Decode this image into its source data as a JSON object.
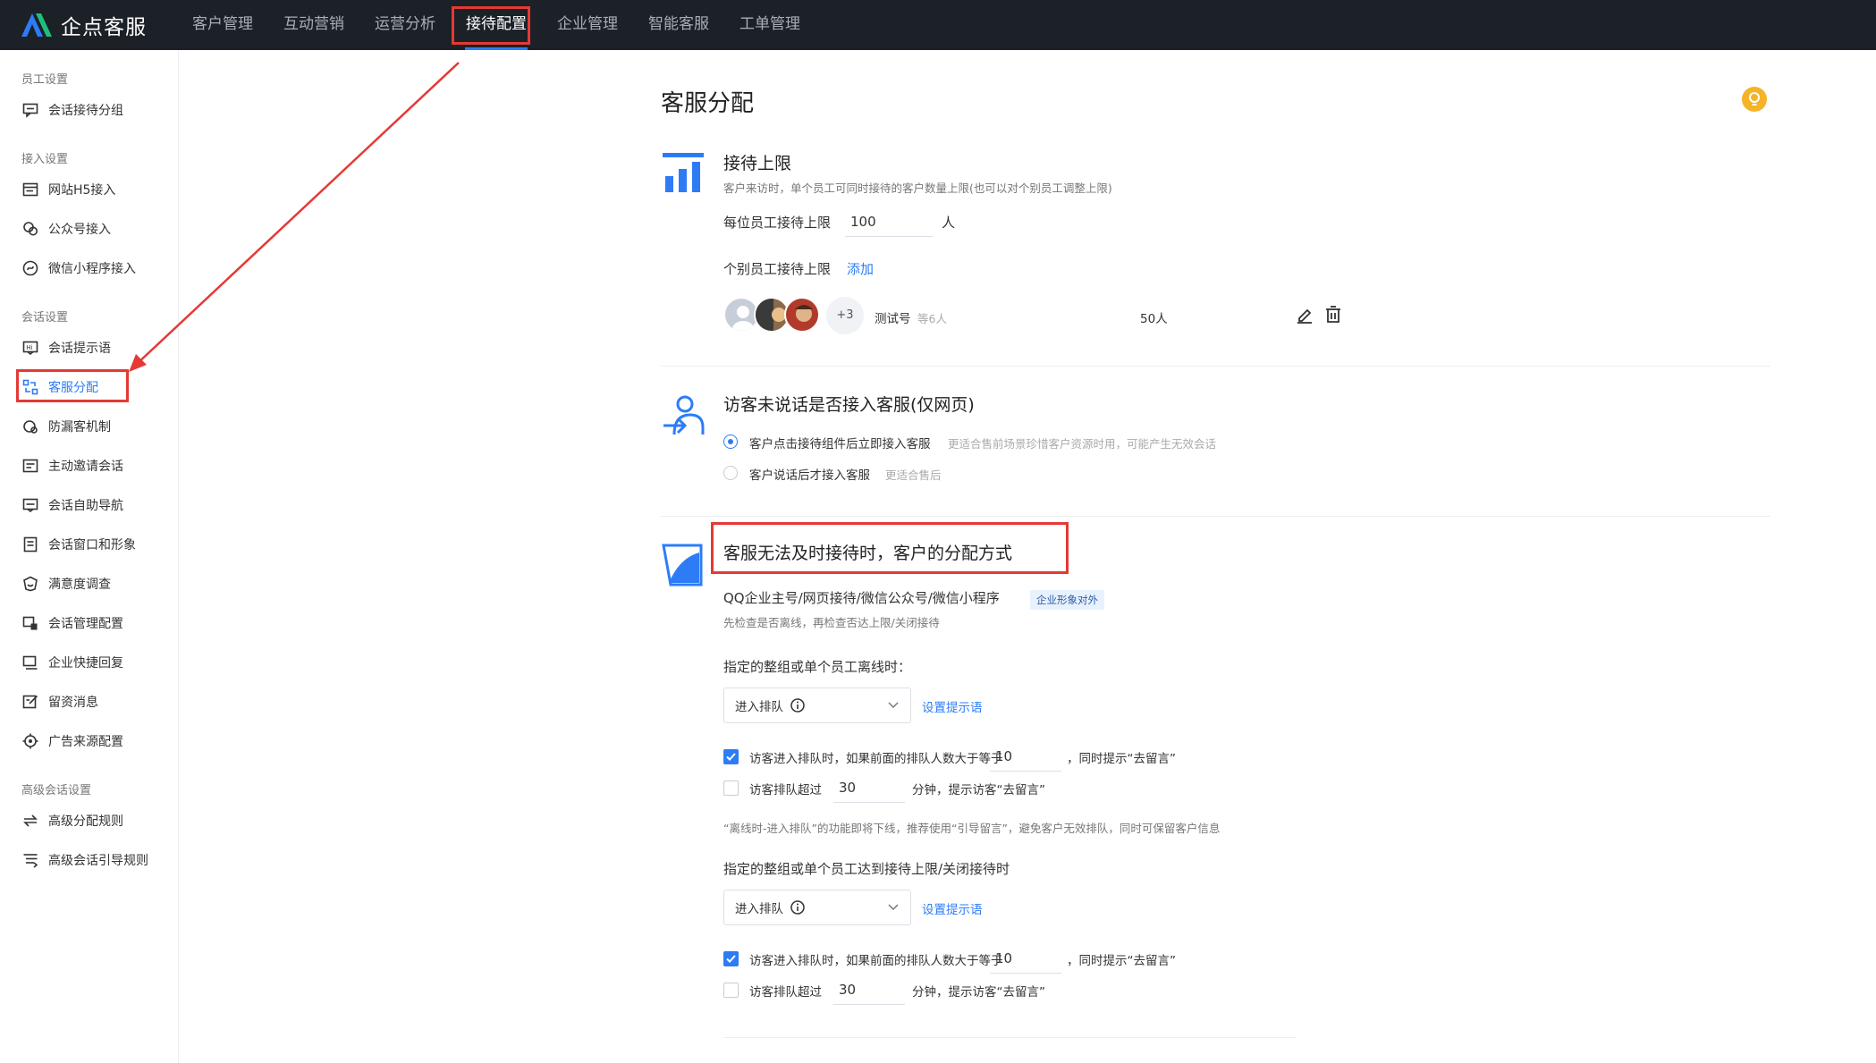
{
  "app": {
    "logo_text": "企点客服"
  },
  "nav": [
    "客户管理",
    "互动营销",
    "运营分析",
    "接待配置",
    "企业管理",
    "智能客服",
    "工单管理"
  ],
  "sidebar": {
    "groups": [
      "员工设置",
      "接入设置",
      "会话设置",
      "高级会话设置"
    ],
    "items": [
      "会话接待分组",
      "网站H5接入",
      "公众号接入",
      "微信小程序接入",
      "会话提示语",
      "客服分配",
      "防漏客机制",
      "主动邀请会话",
      "会话自助导航",
      "会话窗口和形象",
      "满意度调查",
      "会话管理配置",
      "企业快捷回复",
      "留资消息",
      "广告来源配置",
      "高级分配规则",
      "高级会话引导规则"
    ]
  },
  "page": {
    "title": "客服分配"
  },
  "sec1": {
    "title": "接待上限",
    "desc": "客户来访时，单个员工可同时接待的客户数量上限(也可以对个别员工调整上限)",
    "per_label": "每位员工接待上限",
    "per_value": "100",
    "per_unit": "人",
    "indiv_label": "个别员工接待上限",
    "add_link": "添加",
    "more_count": "+3",
    "group_name": "测试号",
    "group_count": "等6人",
    "limit": "50人"
  },
  "sec2": {
    "title": "访客未说话是否接入客服(仅网页)",
    "opt1": "客户点击接待组件后立即接入客服",
    "opt1_hint": "更适合售前场景珍惜客户资源时用，可能产生无效会话",
    "opt2": "客户说话后才接入客服",
    "opt2_hint": "更适合售后"
  },
  "sec3": {
    "title": "客服无法及时接待时，客户的分配方式",
    "sub": "QQ企业主号/网页接待/微信公众号/微信小程序",
    "badge": "企业形象对外",
    "desc": "先检查是否离线，再检查否达上限/关闭接待",
    "offline_label": "指定的整组或单个员工离线时：",
    "select_value": "进入排队",
    "set_tip": "设置提示语",
    "cb1_pre": "访客进入排队时，如果前面的排队人数大于等于",
    "cb1_val": "10",
    "cb1_post": "，同时提示“去留言”",
    "cb2_pre": "访客排队超过",
    "cb2_val": "30",
    "cb2_post": "分钟，提示访客“去留言”",
    "notice": "“离线时-进入排队”的功能即将下线，推荐使用“引导留言”，避免客户无效排队，同时可保留客户信息",
    "limit_label": "指定的整组或单个员工达到接待上限/关闭接待时"
  },
  "colors": {
    "accent": "#2d7cf6",
    "topbar": "#1c2027",
    "highlight": "#e53935",
    "tip": "#f5b325"
  }
}
